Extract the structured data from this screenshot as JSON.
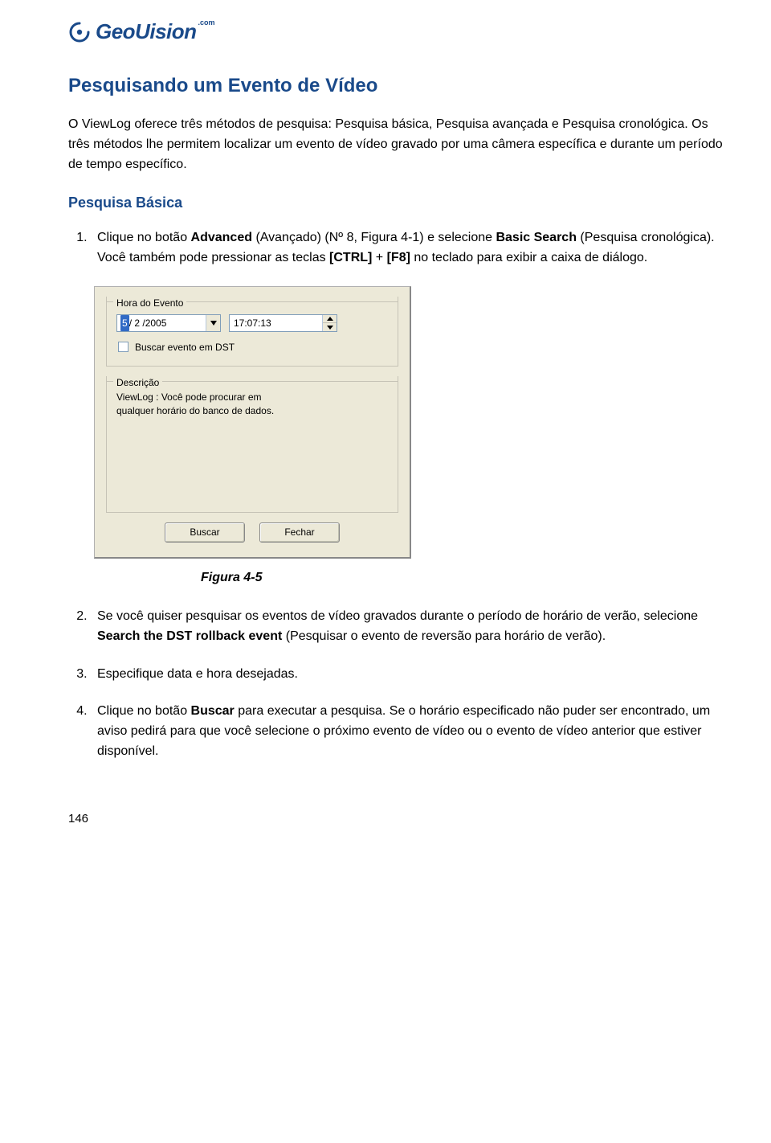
{
  "logo": {
    "brand_geo": "Geo",
    "brand_vision": "Uision",
    "brand_suffix": ".com"
  },
  "title": "Pesquisando um Evento de Vídeo",
  "intro": "O ViewLog oferece três métodos de pesquisa: Pesquisa básica, Pesquisa avançada e Pesquisa cronológica. Os três métodos lhe permitem localizar um evento de vídeo gravado por uma câmera específica e durante um período de tempo específico.",
  "subhead": "Pesquisa Básica",
  "step1": {
    "pre": "Clique no botão ",
    "bold1": "Advanced",
    "mid1": " (Avançado) (Nº 8, Figura 4-1) e selecione ",
    "bold2": "Basic Search",
    "mid2": " (Pesquisa cronológica). Você também pode pressionar as teclas ",
    "bold3": "[CTRL]",
    "plus": " + ",
    "bold4": "[F8]",
    "tail": " no teclado para exibir a caixa de diálogo."
  },
  "dialog": {
    "group_time": "Hora do Evento",
    "date_sel": "5",
    "date_rest": "/ 2 /2005",
    "time": "17:07:13",
    "dst_label": "Buscar evento em DST",
    "group_desc": "Descrição",
    "desc_l1": "ViewLog :  Você pode procurar em",
    "desc_l2": "qualquer horário do banco de dados.",
    "btn_search": "Buscar",
    "btn_close": "Fechar"
  },
  "fig_caption": "Figura 4-5",
  "step2": {
    "pre": "Se você quiser pesquisar os eventos de vídeo gravados durante o período de horário de verão, selecione ",
    "bold": "Search the DST rollback event",
    "tail": " (Pesquisar o evento de reversão para horário de verão)."
  },
  "step3": "Especifique data e hora desejadas.",
  "step4": {
    "pre": "Clique no botão ",
    "bold": "Buscar",
    "tail": " para executar a pesquisa. Se o horário especificado não puder ser encontrado, um aviso pedirá para que você selecione o próximo evento de vídeo ou o evento de vídeo anterior que estiver disponível."
  },
  "page_number": "146"
}
